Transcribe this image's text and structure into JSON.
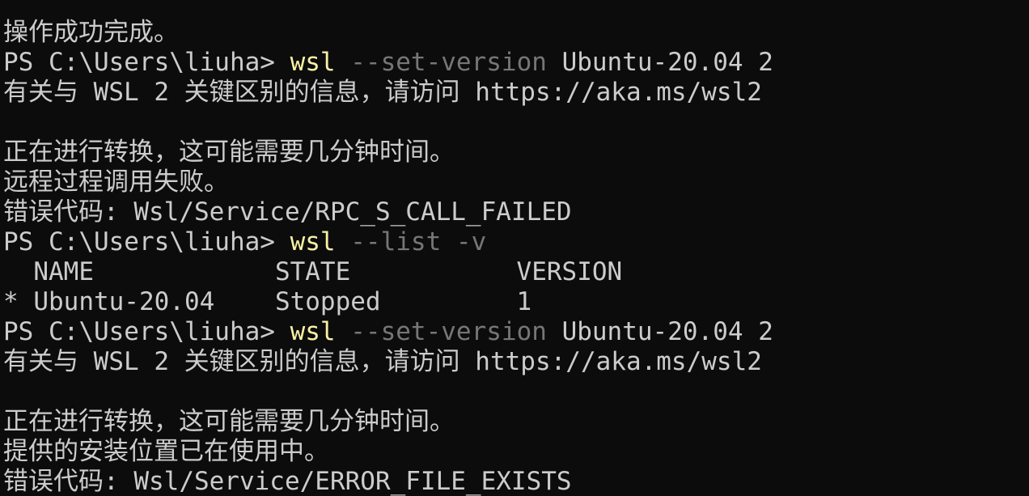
{
  "window": {
    "colors": {
      "background": "#0c0c0c",
      "foreground": "#cccccc",
      "command": "#f9f1a5",
      "parameter": "#767676"
    }
  },
  "terminal": {
    "lines": [
      {
        "type": "output",
        "text": "操作成功完成。"
      },
      {
        "type": "command",
        "prompt": "PS C:\\Users\\liuha> ",
        "cmd": "wsl",
        "params": " --set-version",
        "args": " Ubuntu-20.04 2"
      },
      {
        "type": "output",
        "text": "有关与 WSL 2 关键区别的信息，请访问 https://aka.ms/wsl2"
      },
      {
        "type": "output",
        "text": ""
      },
      {
        "type": "output",
        "text": "正在进行转换，这可能需要几分钟时间。"
      },
      {
        "type": "output",
        "text": "远程过程调用失败。"
      },
      {
        "type": "output",
        "text": "错误代码: Wsl/Service/RPC_S_CALL_FAILED"
      },
      {
        "type": "command",
        "prompt": "PS C:\\Users\\liuha> ",
        "cmd": "wsl",
        "params": " --list -v",
        "args": ""
      },
      {
        "type": "output",
        "text": "  NAME            STATE           VERSION"
      },
      {
        "type": "output",
        "text": "* Ubuntu-20.04    Stopped         1"
      },
      {
        "type": "command",
        "prompt": "PS C:\\Users\\liuha> ",
        "cmd": "wsl",
        "params": " --set-version",
        "args": " Ubuntu-20.04 2"
      },
      {
        "type": "output",
        "text": "有关与 WSL 2 关键区别的信息，请访问 https://aka.ms/wsl2"
      },
      {
        "type": "output",
        "text": ""
      },
      {
        "type": "output",
        "text": "正在进行转换，这可能需要几分钟时间。"
      },
      {
        "type": "output",
        "text": "提供的安装位置已在使用中。"
      },
      {
        "type": "output",
        "text": "错误代码: Wsl/Service/ERROR_FILE_EXISTS"
      }
    ]
  }
}
